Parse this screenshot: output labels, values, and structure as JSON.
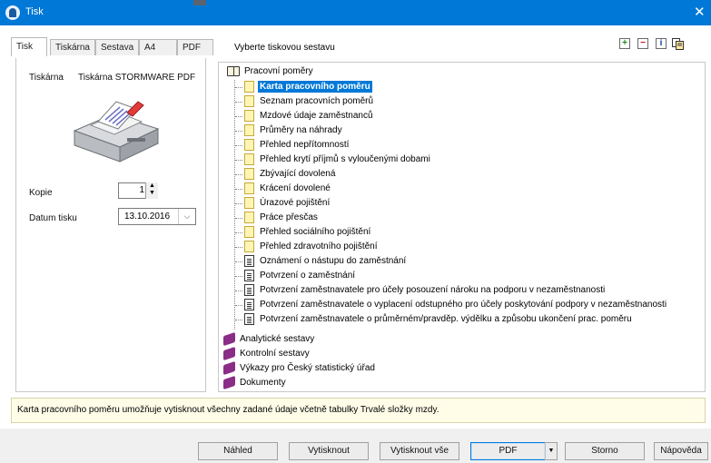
{
  "window": {
    "title": "Tisk",
    "close_glyph": "✕"
  },
  "tabs": [
    {
      "label": "Tisk",
      "active": true
    },
    {
      "label": "Tiskárna",
      "active": false
    },
    {
      "label": "Sestava",
      "active": false
    },
    {
      "label": "A4",
      "active": false
    },
    {
      "label": "PDF",
      "active": false
    }
  ],
  "section_title": "Vyberte tiskovou sestavu",
  "toolbar_icons": [
    "expand-plus-icon",
    "collapse-minus-icon",
    "info-icon",
    "copy-report-icon"
  ],
  "left": {
    "printer_label": "Tiskárna",
    "printer_value": "Tiskárna STORMWARE PDF",
    "copies_label": "Kopie",
    "copies_value": "1",
    "date_label": "Datum tisku",
    "date_value": "13.10.2016"
  },
  "tree": {
    "root": "Pracovní poměry",
    "children": [
      {
        "label": "Karta pracovního poměru",
        "icon": "note",
        "selected": true
      },
      {
        "label": "Seznam pracovních poměrů",
        "icon": "note"
      },
      {
        "label": "Mzdové údaje zaměstnanců",
        "icon": "note"
      },
      {
        "label": "Průměry na náhrady",
        "icon": "note"
      },
      {
        "label": "Přehled nepřítomností",
        "icon": "note"
      },
      {
        "label": "Přehled krytí příjmů s vyloučenými dobami",
        "icon": "note"
      },
      {
        "label": "Zbývající dovolená",
        "icon": "note"
      },
      {
        "label": "Krácení dovolené",
        "icon": "note"
      },
      {
        "label": "Úrazové pojištění",
        "icon": "note"
      },
      {
        "label": "Práce přesčas",
        "icon": "note"
      },
      {
        "label": "Přehled sociálního pojištění",
        "icon": "note"
      },
      {
        "label": "Přehled zdravotního pojištění",
        "icon": "note"
      },
      {
        "label": "Oznámení o nástupu do zaměstnání",
        "icon": "doc"
      },
      {
        "label": "Potvrzení o zaměstnání",
        "icon": "doc"
      },
      {
        "label": "Potvrzení zaměstnavatele pro účely posouzení nároku na podporu v nezaměstnanosti",
        "icon": "doc"
      },
      {
        "label": "Potvrzení zaměstnavatele o vyplacení odstupného pro účely poskytování podpory v nezaměstnanosti",
        "icon": "doc"
      },
      {
        "label": "Potvrzení zaměstnavatele o průměrném/pravděp. výdělku a způsobu ukončení prac. poměru",
        "icon": "doc"
      }
    ],
    "groups": [
      {
        "label": "Analytické sestavy"
      },
      {
        "label": "Kontrolní sestavy"
      },
      {
        "label": "Výkazy pro Český statistický úřad"
      },
      {
        "label": "Dokumenty"
      }
    ]
  },
  "info_text": "Karta pracovního poměru umožňuje vytisknout všechny zadané údaje včetně tabulky Trvalé složky mzdy.",
  "buttons": {
    "preview": "Náhled",
    "print": "Vytisknout",
    "print_all": "Vytisknout vše",
    "pdf": "PDF",
    "cancel": "Storno",
    "help": "Nápověda"
  },
  "colors": {
    "titlebar": "#0078d7",
    "selection": "#0078d7",
    "book_icon": "#8a2d86",
    "note_icon": "#fff6b5"
  }
}
